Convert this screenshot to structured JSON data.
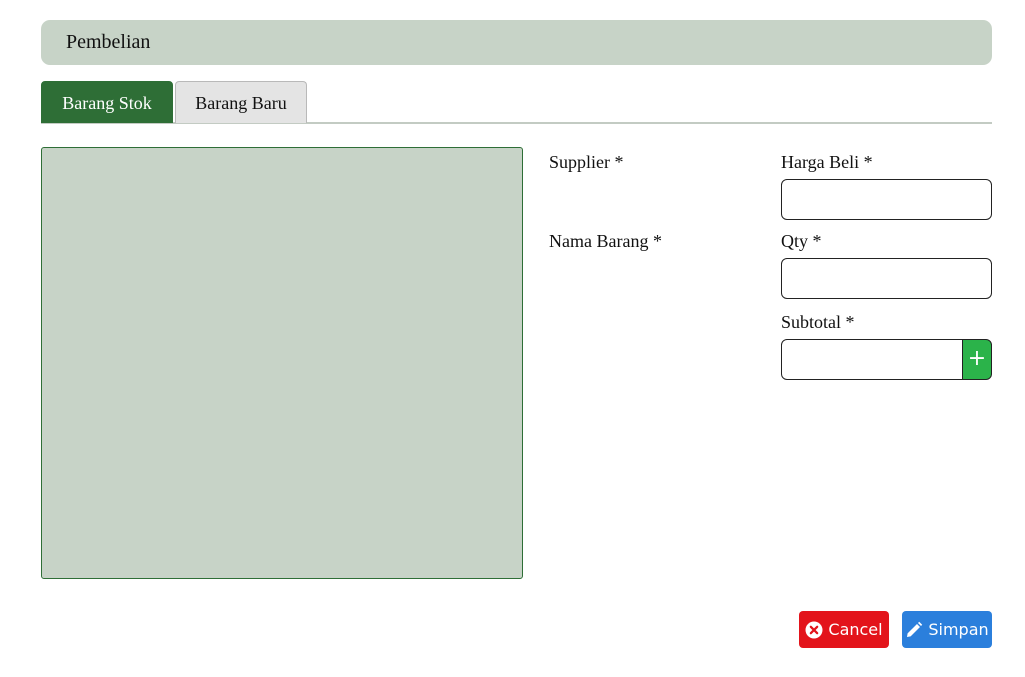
{
  "header": {
    "title": "Pembelian"
  },
  "tabs": [
    {
      "label": "Barang Stok",
      "active": true
    },
    {
      "label": "Barang Baru",
      "active": false
    }
  ],
  "form": {
    "supplier_label": "Supplier *",
    "nama_barang_label": "Nama Barang *",
    "harga_beli_label": "Harga Beli *",
    "harga_beli_value": "",
    "qty_label": "Qty *",
    "qty_value": "",
    "subtotal_label": "Subtotal *",
    "subtotal_value": "",
    "add_icon": "plus-icon",
    "add_symbol": "+"
  },
  "actions": {
    "cancel_label": "Cancel",
    "cancel_icon": "close-circle-icon",
    "save_label": "Simpan",
    "save_icon": "pencil-icon"
  },
  "colors": {
    "accent_green": "#2e6e36",
    "panel_bg": "#c7d3c7",
    "add_button": "#2bb34a",
    "cancel_button": "#e3141b",
    "save_button": "#2b7fdc"
  }
}
